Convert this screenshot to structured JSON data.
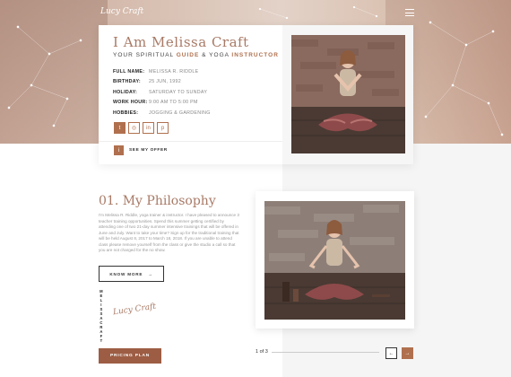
{
  "hero": {
    "logo": "Lucy Craft",
    "menu_icon": "hamburger-icon"
  },
  "profile": {
    "name": "I Am Melissa Craft",
    "subtitle_prefix": "YOUR SPIRITUAL ",
    "subtitle_guide": "GUIDE",
    "subtitle_mid": " & YOGA ",
    "subtitle_instructor": "INSTRUCTOR",
    "details": [
      {
        "key": "FULL NAME:",
        "value": "MELISSA R. RIDDLE"
      },
      {
        "key": "BIRTHDAY:",
        "value": "25 JUN, 1992"
      },
      {
        "key": "HOLIDAY:",
        "value": "SATURDAY TO SUNDAY"
      },
      {
        "key": "WORK HOUR:",
        "value": "9:00 AM TO 5:00 PM"
      },
      {
        "key": "HOBBIES:",
        "value": "JOGGING & GARDENING"
      }
    ],
    "socials": [
      {
        "icon": "twitter-icon",
        "glyph": "t"
      },
      {
        "icon": "github-icon",
        "glyph": "◎"
      },
      {
        "icon": "linkedin-icon",
        "glyph": "in"
      },
      {
        "icon": "pinterest-icon",
        "glyph": "p"
      }
    ],
    "offer_icon": "i",
    "offer_label": "SEE MY OFFER"
  },
  "philosophy": {
    "title": "01. My Philosophy",
    "text": "I'm Melissa R. Riddle, yoga trainer & instructor. I have pleased to announce 3 teacher training opportunities. Spend this summer getting certified by attending one of two 21-day summer intensive trainings that will be offered in June and July. Want to take your time? Sign up for the traditional training that will be held August 8, 2017 to March 18, 2018. If you are unable to attend class please remove yourself from the class or give the studio a call so that you are not charged for the no show.",
    "know_more": "KNOW MORE",
    "know_more_arrow": "→",
    "vertical_name": "MELISSACRAFT",
    "signature": "Lucy Craft",
    "pricing": "PRICING PLAN"
  },
  "pager": {
    "text": "1 of 3",
    "prev": "←",
    "next": "→"
  },
  "colors": {
    "accent": "#b0704e",
    "title": "#a87a66"
  }
}
